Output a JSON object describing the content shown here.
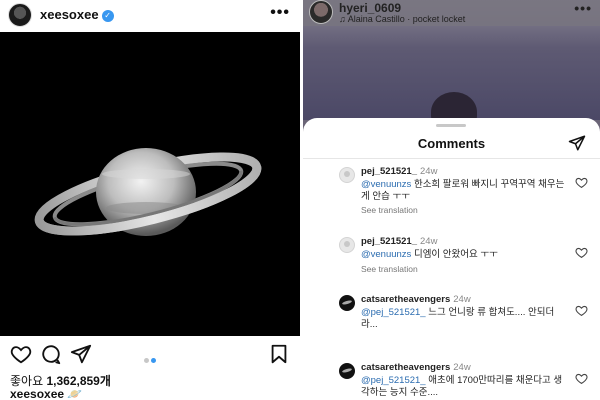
{
  "left": {
    "username": "xeesoxee",
    "more": "•••",
    "likes_prefix": "좋아요",
    "likes_count": "1,362,859개",
    "caption_user": "xeesoxee",
    "caption_emoji": "🪐",
    "carousel_dots": 2,
    "carousel_active": 2
  },
  "right": {
    "username": "hyeri_0609",
    "song": "♫ Alaina Castillo · pocket locket",
    "more": "•••",
    "sheet_title": "Comments",
    "comments": [
      {
        "user": "pej_521521_",
        "time": "24w",
        "mention": "@venuunzs",
        "text": " 한소희 팔로워 빠지니 꾸역꾸역 채우는 게 안습 ㅜㅜ",
        "translate": "See translation",
        "avatar": "gray"
      },
      {
        "user": "pej_521521_",
        "time": "24w",
        "mention": "@venuunzs",
        "text": " 디엠이 안왔어요 ㅜㅜ",
        "translate": "See translation",
        "avatar": "gray"
      },
      {
        "user": "catsaretheavengers",
        "time": "24w",
        "mention": "@pej_521521_",
        "text": " 느그 언니랑 류 합쳐도.... 안되더라...",
        "translate": "See translation",
        "avatar": "black"
      },
      {
        "user": "catsaretheavengers",
        "time": "24w",
        "mention": "@pej_521521_",
        "text": " 애초에 1700만따리를 채운다고 생각하는 능지 수준....",
        "translate": "",
        "avatar": "black"
      }
    ]
  },
  "colors": {
    "verified": "#3897f0",
    "mention": "#2b6cb0",
    "carousel_active": "#3897f0",
    "carousel_inactive": "#c7c7c7"
  }
}
